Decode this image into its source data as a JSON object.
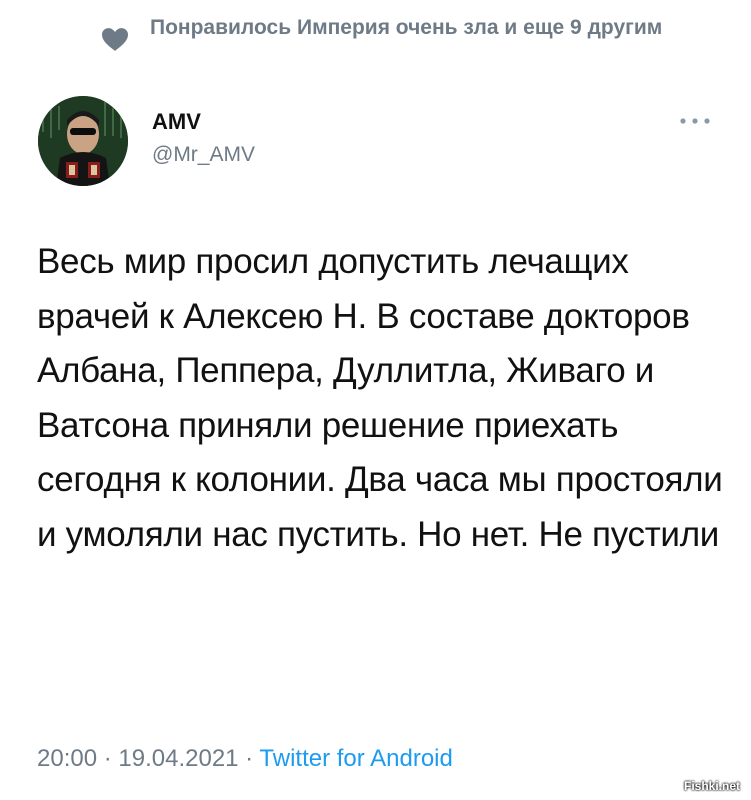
{
  "social_context": {
    "text": "Понравилось Империя очень зла и еще 9 другим"
  },
  "author": {
    "name": "AMV",
    "handle": "@Mr_AMV"
  },
  "tweet": {
    "text": "Весь мир просил допустить лечащих врачей к Алексею Н. В составе докторов Албана, Пеппера, Дуллитла, Живаго и Ватсона приняли решение приехать сегодня к колонии. Два часа мы простояли и умоляли нас пустить. Но нет. Не пустили"
  },
  "meta": {
    "time": "20:00",
    "date": "19.04.2021",
    "separator": " · ",
    "source": "Twitter for Android"
  },
  "watermark": {
    "text": "Fishki.net"
  },
  "colors": {
    "muted": "#6e7b87",
    "link": "#1d9bf0",
    "text": "#111111"
  }
}
